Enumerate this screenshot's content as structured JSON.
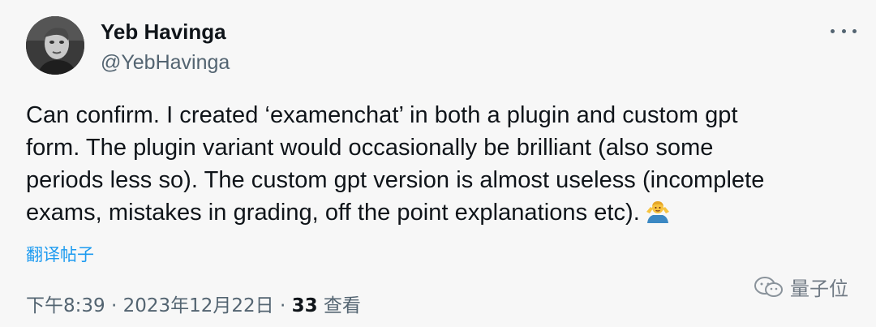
{
  "author": {
    "name": "Yeb Havinga",
    "handle": "@YebHavinga",
    "avatar_icon": "avatar-photo"
  },
  "more_icon": "more-horizontal-icon",
  "tweet": {
    "lines": [
      "Can confirm. I created ‘examenchat’ in both a plugin and custom gpt",
      "form. The plugin variant would occasionally be brilliant (also some",
      "periods less so). The custom gpt version is almost useless (incomplete",
      "exams, mistakes in grading, off the point explanations etc)."
    ],
    "emoji": "man-shrugging-emoji"
  },
  "translate_label": "翻译帖子",
  "meta": {
    "time": "下午8:39",
    "separator": " · ",
    "date": "2023年12月22日",
    "views_count": "33",
    "views_label": " 查看"
  },
  "watermark": {
    "text": "量子位"
  },
  "colors": {
    "link": "#1d9bf0",
    "secondary": "#536471",
    "text": "#0f1419",
    "background": "#f7f7f7"
  }
}
